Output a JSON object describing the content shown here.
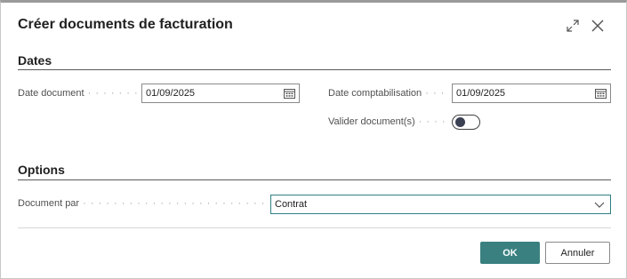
{
  "dialog": {
    "title": "Créer documents de facturation",
    "expand_icon": "expand-icon",
    "close_icon": "close-icon"
  },
  "sections": {
    "dates": {
      "title": "Dates",
      "document_date_label": "Date document",
      "document_date_value": "01/09/2025",
      "posting_date_label": "Date comptabilisation",
      "posting_date_value": "01/09/2025",
      "post_documents_label": "Valider document(s)",
      "post_documents_enabled": false
    },
    "options": {
      "title": "Options",
      "document_per_label": "Document par",
      "document_per_value": "Contrat"
    }
  },
  "buttons": {
    "ok": "OK",
    "cancel": "Annuler"
  },
  "colors": {
    "accent": "#3a8080",
    "focus_border": "#2f7f86"
  }
}
